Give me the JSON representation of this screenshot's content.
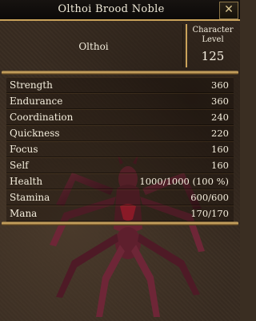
{
  "window": {
    "title": "Olthoi Brood Noble",
    "close_glyph": "✕"
  },
  "header": {
    "creature_type": "Olthoi",
    "level_label_line1": "Character",
    "level_label_line2": "Level",
    "level_value": "125"
  },
  "stats": [
    {
      "label": "Strength",
      "value": "360"
    },
    {
      "label": "Endurance",
      "value": "360"
    },
    {
      "label": "Coordination",
      "value": "240"
    },
    {
      "label": "Quickness",
      "value": "220"
    },
    {
      "label": "Focus",
      "value": "160"
    },
    {
      "label": "Self",
      "value": "160"
    },
    {
      "label": "Health",
      "value": "1000/1000 (100 %)"
    },
    {
      "label": "Stamina",
      "value": "600/600"
    },
    {
      "label": "Mana",
      "value": "170/170"
    }
  ],
  "colors": {
    "accent_gold": "#c9a25a",
    "text": "#f4eedd",
    "creature_body": "#7a2a3a",
    "creature_highlight": "#d0233a"
  }
}
